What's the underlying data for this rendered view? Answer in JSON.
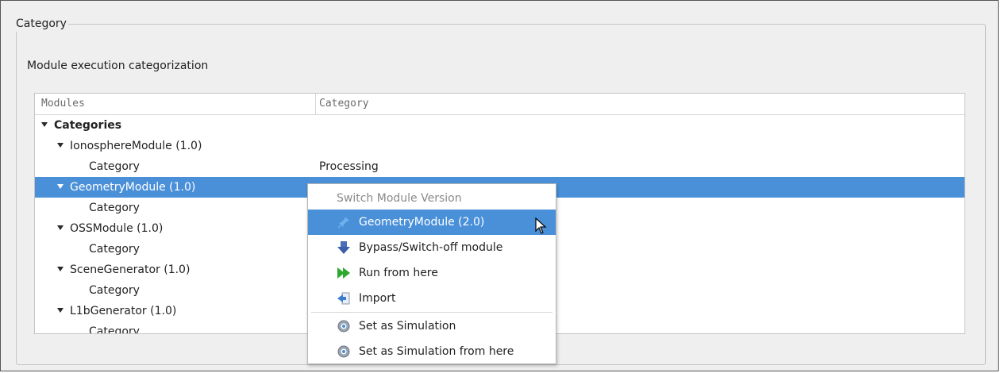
{
  "group": {
    "title": "Category",
    "description": "Module execution categorization"
  },
  "tree": {
    "columns": [
      "Modules",
      "Category"
    ],
    "rows": [
      {
        "name": "Categories",
        "value": "",
        "bold": true,
        "expanded": true
      },
      {
        "name": "IonosphereModule (1.0)",
        "value": "",
        "expanded": true
      },
      {
        "name": "Category",
        "value": "Processing"
      },
      {
        "name": "GeometryModule (1.0)",
        "value": "",
        "expanded": true,
        "selected": true
      },
      {
        "name": "Category",
        "value": ""
      },
      {
        "name": "OSSModule (1.0)",
        "value": "",
        "expanded": true
      },
      {
        "name": "Category",
        "value": ""
      },
      {
        "name": "SceneGenerator (1.0)",
        "value": "",
        "expanded": true
      },
      {
        "name": "Category",
        "value": ""
      },
      {
        "name": "L1bGenerator (1.0)",
        "value": "",
        "expanded": true
      },
      {
        "name": "Category",
        "value": ""
      }
    ]
  },
  "context_menu": {
    "section_title": "Switch Module Version",
    "items": [
      {
        "label": "GeometryModule (2.0)",
        "icon": "pin-icon",
        "highlighted": true
      },
      {
        "label": "Bypass/Switch-off module",
        "icon": "down-arrow-icon"
      },
      {
        "label": "Run from here",
        "icon": "fast-forward-icon"
      },
      {
        "label": "Import",
        "icon": "import-icon"
      },
      {
        "label": "Set as Simulation",
        "icon": "gear-icon"
      },
      {
        "label": "Set as Simulation from here",
        "icon": "gear-icon"
      }
    ]
  },
  "colors": {
    "selection": "#4a90d9",
    "run_icon": "#2fa82f",
    "bypass_icon": "#3b5fa8"
  }
}
